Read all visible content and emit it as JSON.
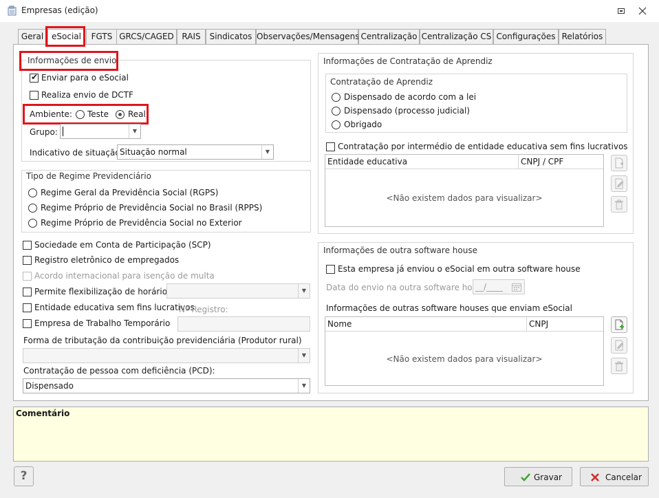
{
  "window": {
    "title": "Empresas (edição)"
  },
  "tabs": [
    {
      "label": "Geral"
    },
    {
      "label": "eSocial"
    },
    {
      "label": "FGTS"
    },
    {
      "label": "GRCS/CAGED"
    },
    {
      "label": "RAIS"
    },
    {
      "label": "Sindicatos"
    },
    {
      "label": "Observações/Mensagens"
    },
    {
      "label": "Centralização"
    },
    {
      "label": "Centralização CS"
    },
    {
      "label": "Configurações"
    },
    {
      "label": "Relatórios"
    }
  ],
  "envio": {
    "title": "Informações de envio",
    "enviar_label": "Enviar para o eSocial",
    "dctf_label": "Realiza envio de DCTF",
    "ambiente_label": "Ambiente:",
    "teste_label": "Teste",
    "real_label": "Real",
    "grupo_label": "Grupo:",
    "grupo_value": "",
    "situacao_label": "Indicativo de situação:",
    "situacao_value": "Situação normal"
  },
  "regime": {
    "title": "Tipo de Regime Previdenciário",
    "options": [
      "Regime Geral da Previdência Social (RGPS)",
      "Regime Próprio de Previdência Social no Brasil (RPPS)",
      "Regime Próprio de Previdência Social no Exterior"
    ]
  },
  "checks": {
    "scp": "Sociedade em Conta de Participação (SCP)",
    "registro": "Registro eletrônico de empregados",
    "acordo": "Acordo internacional para isenção de multa",
    "flexibilizacao": "Permite flexibilização de horários",
    "entidade": "Entidade educativa sem fins lucrativos",
    "nregistro_label": "Nº Registro:",
    "trabalho": "Empresa de Trabalho Temporário"
  },
  "tributacao": {
    "label": "Forma de tributação da contribuição previdenciária (Produtor rural)",
    "value": ""
  },
  "pcd": {
    "label": "Contratação de pessoa com deficiência (PCD):",
    "value": "Dispensado"
  },
  "aprendiz": {
    "title": "Informações de Contratação de Aprendiz",
    "subtitle": "Contratação de Aprendiz",
    "options": [
      "Dispensado de acordo com a lei",
      "Dispensado (processo judicial)",
      "Obrigado"
    ],
    "intermedio_label": "Contratação por intermédio de entidade educativa sem fins lucrativos",
    "grid_cols": [
      "Entidade educativa",
      "CNPJ / CPF"
    ],
    "empty": "<Não existem dados para visualizar>"
  },
  "software": {
    "title": "Informações de outra software house",
    "enviou_label": "Esta empresa já enviou o eSocial em outra software house",
    "data_label": "Data do envio na outra software house:",
    "data_value": "__/____",
    "outras_label": "Informações de outras software houses que enviam eSocial",
    "grid_cols": [
      "Nome",
      "CNPJ"
    ],
    "empty": "<Não existem dados para visualizar>"
  },
  "comentario": {
    "label": "Comentário"
  },
  "footer": {
    "help_label": "?",
    "gravar_label": "Gravar",
    "cancelar_label": "Cancelar"
  },
  "colors": {
    "highlight": "#e0141b",
    "comment_bg": "#ffffe1",
    "ok_green": "#3fa535",
    "cancel_red": "#d22a2a"
  }
}
